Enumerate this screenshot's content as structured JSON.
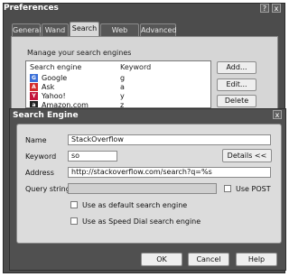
{
  "prefs": {
    "title": "Preferences",
    "titlebar_buttons": [
      "?",
      "x"
    ],
    "tabs": [
      "General",
      "Wand",
      "Search",
      "Web Pages",
      "Advanced"
    ],
    "active_tab": "Search",
    "manage_label": "Manage your search engines",
    "table": {
      "col_engine": "Search engine",
      "col_keyword": "Keyword",
      "rows": [
        {
          "name": "Google",
          "keyword": "g",
          "icon": "google-icon"
        },
        {
          "name": "Ask",
          "keyword": "a",
          "icon": "ask-icon"
        },
        {
          "name": "Yahoo!",
          "keyword": "y",
          "icon": "yahoo-icon"
        },
        {
          "name": "Amazon.com",
          "keyword": "z",
          "icon": "amazon-icon"
        }
      ]
    },
    "buttons": {
      "add": "Add...",
      "edit": "Edit...",
      "delete": "Delete"
    }
  },
  "dialog": {
    "title": "Search Engine",
    "close": "x",
    "name_label": "Name",
    "name_value": "StackOverflow",
    "keyword_label": "Keyword",
    "keyword_value": "so",
    "details_button": "Details <<",
    "address_label": "Address",
    "address_value": "http://stackoverflow.com/search?q=%s",
    "query_label": "Query string",
    "query_value": "",
    "use_post": "Use POST",
    "default_label": "Use as default search engine",
    "speeddial_label": "Use as Speed Dial search engine",
    "ok": "OK",
    "cancel": "Cancel",
    "help": "Help"
  },
  "colors": {
    "dark_chrome": "#4c4c4c",
    "panel": "#d6d6d6"
  }
}
